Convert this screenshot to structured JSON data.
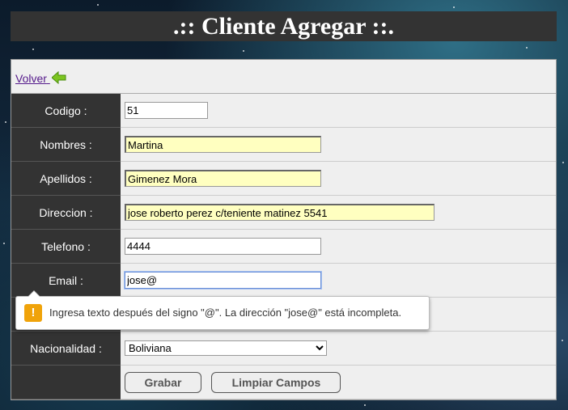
{
  "header": {
    "title": ".:: Cliente Agregar ::."
  },
  "nav": {
    "back_label": "Volver",
    "back_icon": "arrow-left-icon",
    "accent": "#7cc520"
  },
  "form": {
    "codigo": {
      "label": "Codigo :",
      "value": "51"
    },
    "nombres": {
      "label": "Nombres :",
      "value": "Martina"
    },
    "apellidos": {
      "label": "Apellidos :",
      "value": "Gimenez Mora"
    },
    "direccion": {
      "label": "Direccion :",
      "value": "jose roberto perez c/teniente matinez 5541"
    },
    "telefono": {
      "label": "Telefono :",
      "value": "4444"
    },
    "email": {
      "label": "Email :",
      "value": "jose@"
    },
    "nacionalidad": {
      "label": "Nacionalidad :",
      "selected": "Boliviana"
    },
    "buttons": {
      "save": "Grabar",
      "clear": "Limpiar Campos"
    }
  },
  "validation": {
    "icon": "warning-icon",
    "color": "#f0a30a",
    "message": "Ingresa texto después del signo \"@\". La dirección \"jose@\" está incompleta."
  }
}
